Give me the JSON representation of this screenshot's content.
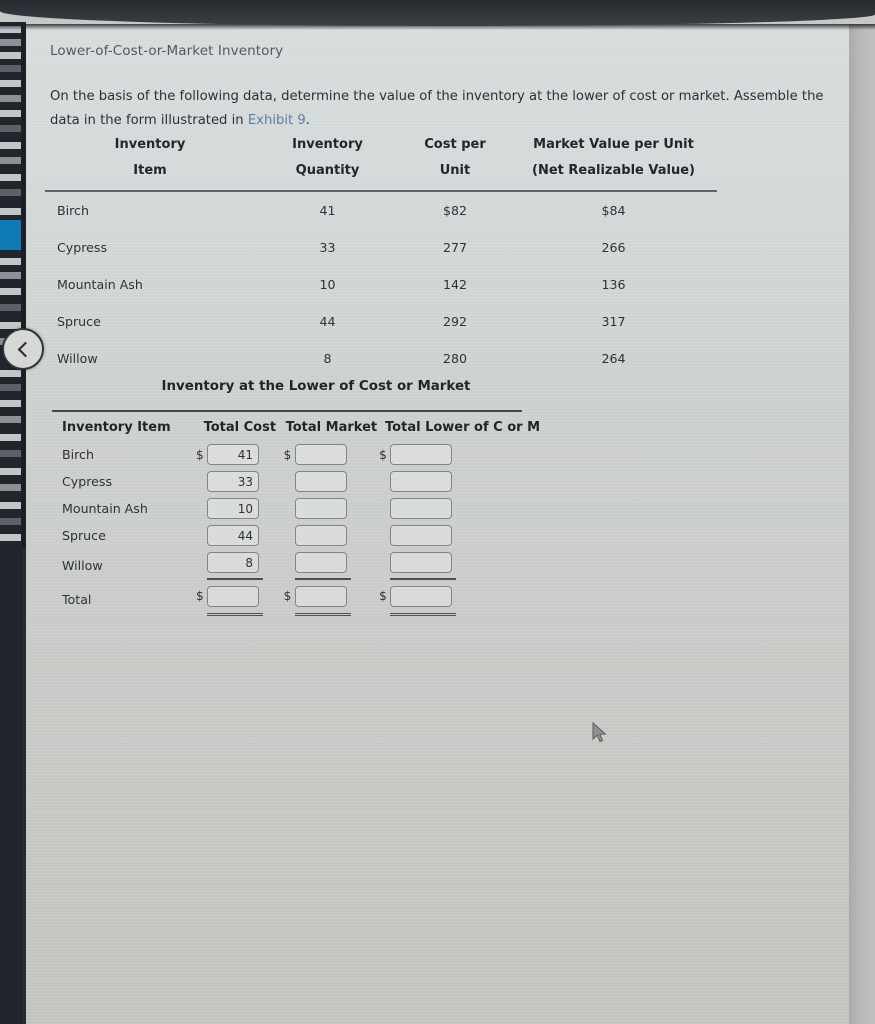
{
  "document": {
    "title": "Lower-of-Cost-or-Market Inventory",
    "prompt_before_link": "On the basis of the following data, determine the value of the inventory at the lower of cost or market. Assemble the data in the form illustrated in ",
    "link_text": "Exhibit 9",
    "prompt_after_link": "."
  },
  "table_one": {
    "headers": [
      {
        "line1": "Inventory",
        "line2": "Item"
      },
      {
        "line1": "Inventory",
        "line2": "Quantity"
      },
      {
        "line1": "Cost per",
        "line2": "Unit"
      },
      {
        "line1": "Market Value per Unit",
        "line2": "(Net Realizable Value)"
      }
    ],
    "rows": [
      {
        "item": "Birch",
        "quantity": "41",
        "cost": "$82",
        "market": "$84"
      },
      {
        "item": "Cypress",
        "quantity": "33",
        "cost": "277",
        "market": "266"
      },
      {
        "item": "Mountain Ash",
        "quantity": "10",
        "cost": "142",
        "market": "136"
      },
      {
        "item": "Spruce",
        "quantity": "44",
        "cost": "292",
        "market": "317"
      },
      {
        "item": "Willow",
        "quantity": "8",
        "cost": "280",
        "market": "264"
      }
    ]
  },
  "table_two": {
    "title": "Inventory at the Lower of Cost or Market",
    "headers": [
      "Inventory Item",
      "Total Cost",
      "Total Market",
      "Total Lower of C or M"
    ],
    "currency_symbol": "$",
    "rows": [
      {
        "item": "Birch",
        "total_cost": "41",
        "total_market": "",
        "total_lower": ""
      },
      {
        "item": "Cypress",
        "total_cost": "33",
        "total_market": "",
        "total_lower": ""
      },
      {
        "item": "Mountain Ash",
        "total_cost": "10",
        "total_market": "",
        "total_lower": ""
      },
      {
        "item": "Spruce",
        "total_cost": "44",
        "total_market": "",
        "total_lower": ""
      },
      {
        "item": "Willow",
        "total_cost": "8",
        "total_market": "",
        "total_lower": ""
      }
    ],
    "total_row": {
      "item": "Total",
      "total_cost": "",
      "total_market": "",
      "total_lower": ""
    }
  },
  "chrome": {
    "back_button_icon": "chevron-left-icon",
    "accent_color": "#0d7ab5",
    "link_color": "#5f7fa0"
  }
}
